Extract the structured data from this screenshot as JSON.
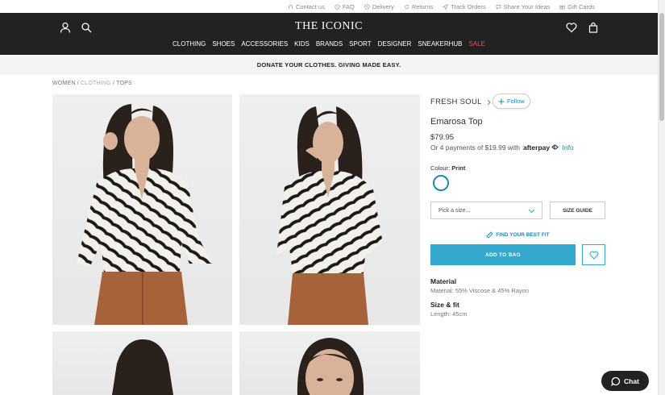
{
  "utility_bar": {
    "items": [
      {
        "icon": "headset-icon",
        "label": "Contact us"
      },
      {
        "icon": "help-icon",
        "label": "FAQ"
      },
      {
        "icon": "clock-icon",
        "label": "Delivery"
      },
      {
        "icon": "return-icon",
        "label": "Returns"
      },
      {
        "icon": "send-icon",
        "label": "Track Orders"
      },
      {
        "icon": "idea-icon",
        "label": "Share Your Ideas"
      },
      {
        "icon": "gift-icon",
        "label": "Gift Cards"
      }
    ]
  },
  "header": {
    "logo": "THE ICONIC",
    "nav": [
      "CLOTHING",
      "SHOES",
      "ACCESSORIES",
      "KIDS",
      "BRANDS",
      "SPORT",
      "DESIGNER",
      "SNEAKERHUB",
      "SALE"
    ],
    "sale_color": "#e8524a"
  },
  "banner": {
    "text": "DONATE YOUR CLOTHES. GIVING MADE EASY."
  },
  "breadcrumb": {
    "women": "WOMEN",
    "sep1": " / ",
    "clothing": "CLOTHING",
    "sep2": " / ",
    "tops": "TOPS"
  },
  "product": {
    "brand": "FRESH SOUL",
    "follow_label": "Follow",
    "title": "Emarosa Top",
    "price": "$79.95",
    "payments_text": "Or 4 payments of $19.99 with",
    "afterpay_label": "afterpay",
    "afterpay_info": "Info",
    "colour_label": "Colour:",
    "colour_value": "Print",
    "size_placeholder": "Pick a size...",
    "size_guide": "SIZE GUIDE",
    "fit_link": "FIND YOUR BEST FIT",
    "add_to_bag": "ADD TO BAG",
    "material_title": "Material",
    "material_text": "Material: 55% Viscose & 45% Rayon",
    "size_fit_title": "Size & fit",
    "size_fit_text": "Length: 45cm"
  },
  "chat": {
    "label": "Chat"
  },
  "colors": {
    "header_bg": "#222222",
    "accent": "#35a8ce",
    "link": "#1f89b3"
  }
}
